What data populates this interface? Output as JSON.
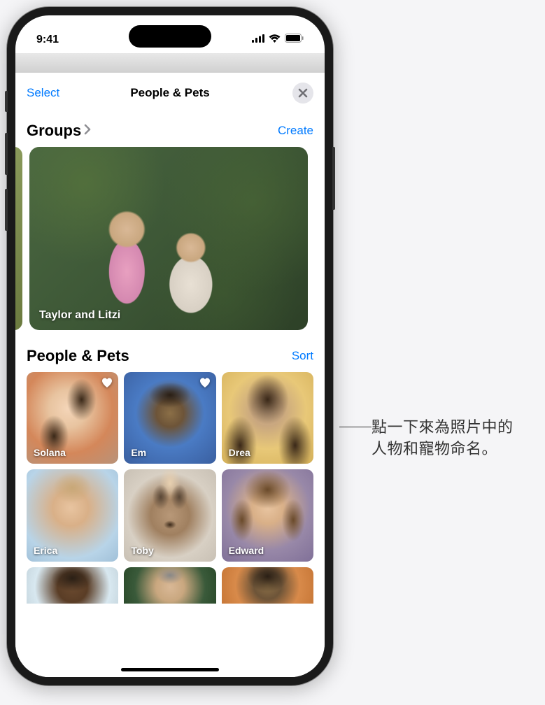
{
  "status": {
    "time": "9:41"
  },
  "nav": {
    "select": "Select",
    "title": "People & Pets"
  },
  "groups": {
    "title": "Groups",
    "create": "Create",
    "card_label": "Taylor and Litzi"
  },
  "people": {
    "title": "People & Pets",
    "sort": "Sort",
    "tiles": [
      {
        "name": "Solana",
        "favorite": true
      },
      {
        "name": "Em",
        "favorite": true
      },
      {
        "name": "Drea",
        "favorite": false
      },
      {
        "name": "Erica",
        "favorite": false
      },
      {
        "name": "Toby",
        "favorite": false
      },
      {
        "name": "Edward",
        "favorite": false
      }
    ]
  },
  "callout": {
    "line1": "點一下來為照片中的",
    "line2": "人物和寵物命名。"
  }
}
